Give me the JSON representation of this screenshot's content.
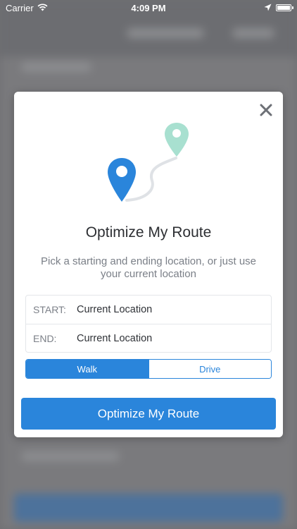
{
  "status_bar": {
    "carrier": "Carrier",
    "time": "4:09 PM",
    "icons": [
      "wifi-icon",
      "location-arrow-icon",
      "battery-icon"
    ]
  },
  "modal": {
    "title": "Optimize My Route",
    "subtitle": "Pick a starting and ending location, or just use your current location",
    "locations": [
      {
        "label": "START:",
        "value": "Current Location"
      },
      {
        "label": "END:",
        "value": "Current Location"
      }
    ],
    "mode_options": [
      {
        "label": "Walk",
        "selected": true
      },
      {
        "label": "Drive",
        "selected": false
      }
    ],
    "primary_button": "Optimize My Route",
    "icons": [
      "close-icon",
      "route-illustration"
    ]
  },
  "colors": {
    "accent": "#2a85db",
    "pin_start": "#2a85db",
    "pin_end": "#a8e0d0",
    "title_text": "#2d2f33",
    "subtitle_text": "#7a7f87"
  }
}
